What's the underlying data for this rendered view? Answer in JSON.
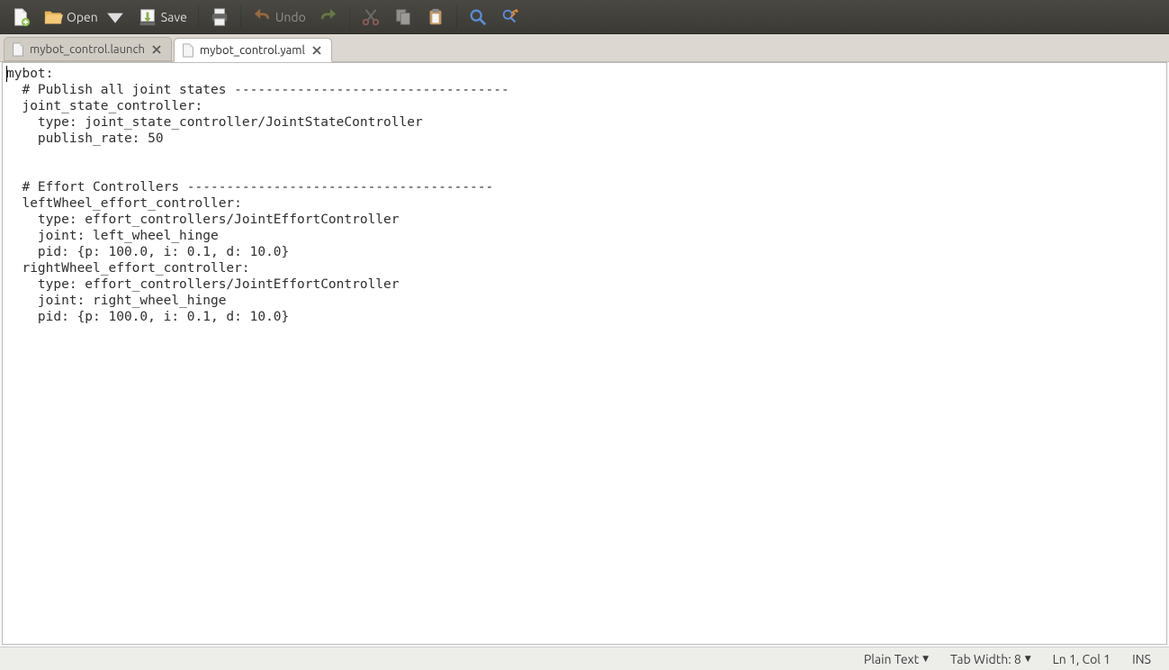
{
  "toolbar": {
    "open_label": "Open",
    "save_label": "Save",
    "undo_label": "Undo"
  },
  "tabs": [
    {
      "label": "mybot_control.launch",
      "active": false
    },
    {
      "label": "mybot_control.yaml",
      "active": true
    }
  ],
  "editor_text": "mybot:\n  # Publish all joint states -----------------------------------\n  joint_state_controller:\n    type: joint_state_controller/JointStateController\n    publish_rate: 50\n\n\n  # Effort Controllers ---------------------------------------\n  leftWheel_effort_controller:\n    type: effort_controllers/JointEffortController\n    joint: left_wheel_hinge\n    pid: {p: 100.0, i: 0.1, d: 10.0}\n  rightWheel_effort_controller:\n    type: effort_controllers/JointEffortController\n    joint: right_wheel_hinge\n    pid: {p: 100.0, i: 0.1, d: 10.0}\n",
  "status": {
    "syntax_label": "Plain Text",
    "tab_width_label": "Tab Width: 8",
    "position_label": "Ln 1, Col 1",
    "insert_mode": "INS"
  }
}
